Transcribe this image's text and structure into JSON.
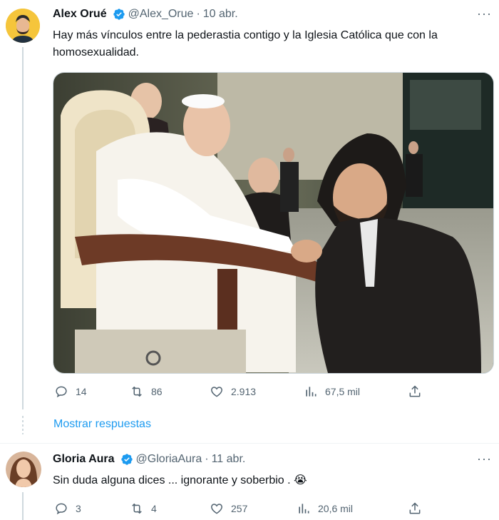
{
  "tweets": [
    {
      "author": "Alex Orué",
      "handle": "@Alex_Orue",
      "sep": "·",
      "date": "10 abr.",
      "text": "Hay más vínculos entre la pederastia contigo y la Iglesia Católica que con la homosexualidad.",
      "actions": {
        "replies": "14",
        "retweets": "86",
        "likes": "2.913",
        "views": "67,5 mil"
      }
    },
    {
      "author": "Gloria Aura",
      "handle": "@GloriaAura",
      "sep": "·",
      "date": "11 abr.",
      "text": "Sin duda alguna dices ... ignorante y soberbio .",
      "emoji": "😭",
      "actions": {
        "replies": "3",
        "retweets": "4",
        "likes": "257",
        "views": "20,6 mil"
      }
    }
  ],
  "show_replies": "Mostrar respuestas",
  "more_glyph": "···",
  "colors": {
    "accent": "#1d9bf0",
    "muted": "#536471",
    "text": "#0f1419",
    "line": "#cfd9de"
  }
}
